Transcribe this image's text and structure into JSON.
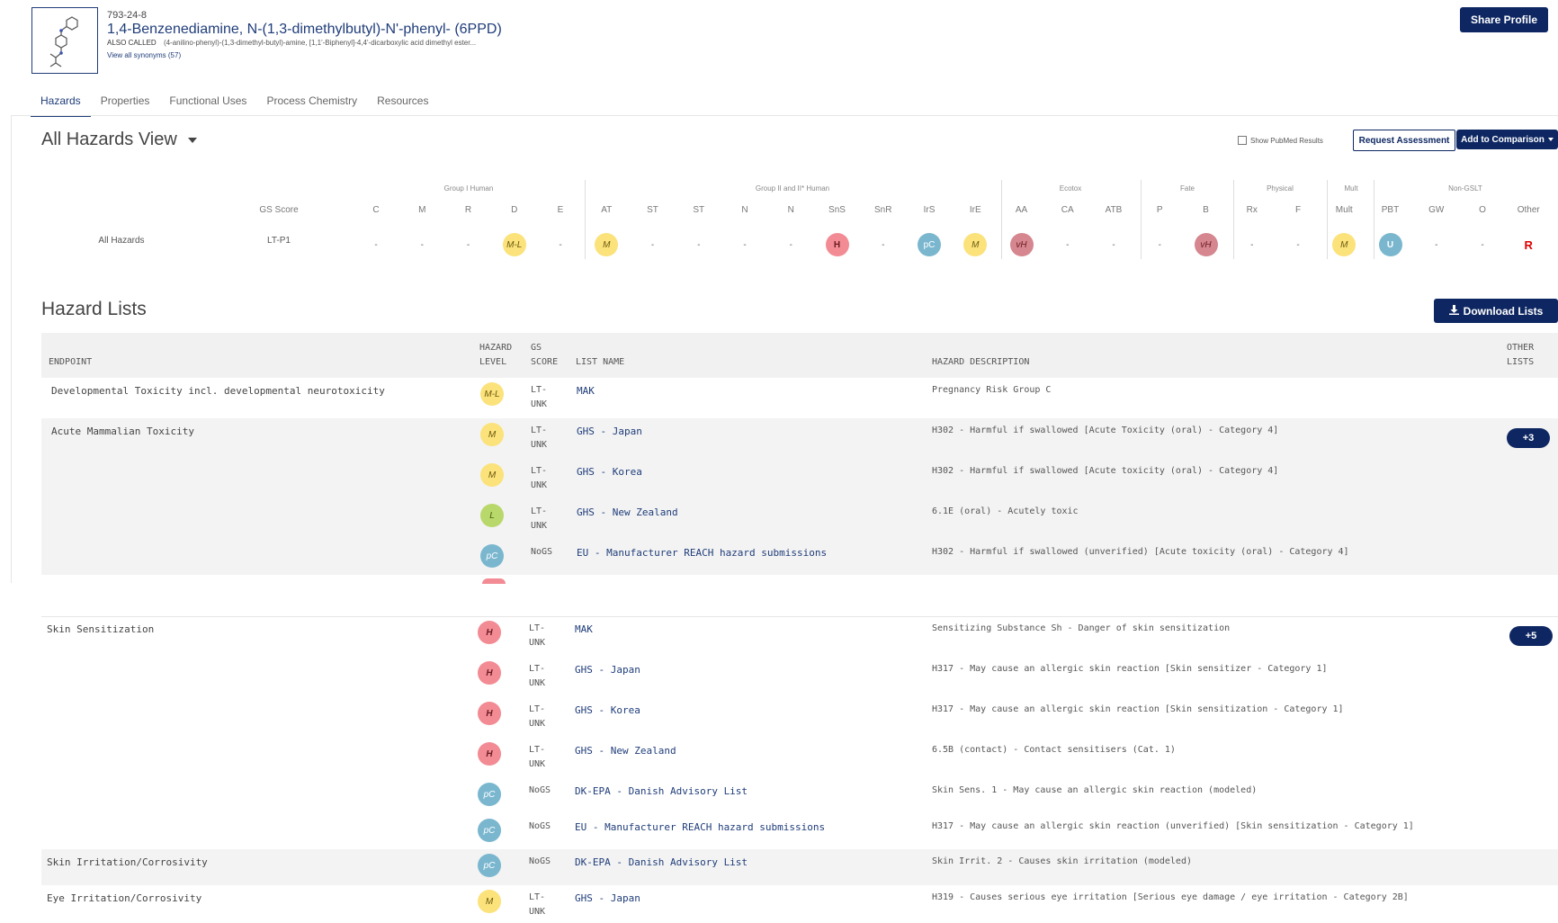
{
  "header": {
    "cas": "793-24-8",
    "name": "1,4-Benzenediamine, N-(1,3-dimethylbutyl)-N'-phenyl- (6PPD)",
    "also_called_label": "ALSO CALLED",
    "also_called": "(4-anilino-phenyl)-(1,3-dimethyl-butyl)-amine, [1,1'-Biphenyl]-4,4'-dicarboxylic acid dimethyl ester...",
    "synonyms_link": "View all synonyms (57)",
    "share_label": "Share Profile"
  },
  "tabs": [
    "Hazards",
    "Properties",
    "Functional Uses",
    "Process Chemistry",
    "Resources"
  ],
  "active_tab": "Hazards",
  "view": {
    "title": "All Hazards View",
    "pubmed_label": "Show PubMed Results",
    "request_label": "Request Assessment",
    "compare_label": "Add to Comparison"
  },
  "hazard_table": {
    "groups": [
      "Group I Human",
      "Group II and II* Human",
      "Ecotox",
      "Fate",
      "Physical",
      "Mult",
      "Non-GSLT"
    ],
    "score_label": "GS Score",
    "columns": [
      "C",
      "M",
      "R",
      "D",
      "E",
      "AT",
      "ST",
      "ST",
      "N",
      "N",
      "SnS",
      "SnR",
      "IrS",
      "IrE",
      "AA",
      "CA",
      "ATB",
      "P",
      "B",
      "Rx",
      "F",
      "Mult",
      "PBT",
      "GW",
      "O",
      "Other"
    ],
    "row_label": "All Hazards",
    "gs_score": "LT-P1",
    "values": [
      "-",
      "-",
      "-",
      "M-L",
      "-",
      "M",
      "-",
      "-",
      "-",
      "-",
      "H",
      "-",
      "pC",
      "M",
      "vH",
      "-",
      "-",
      "-",
      "vH",
      "-",
      "-",
      "M",
      "U",
      "-",
      "-",
      "R"
    ]
  },
  "lists": {
    "title": "Hazard Lists",
    "download_label": "Download Lists",
    "headers": {
      "endpoint": "ENDPOINT",
      "hazard_level": [
        "HAZARD",
        "LEVEL"
      ],
      "gs_score": [
        "GS",
        "SCORE"
      ],
      "list_name": "LIST NAME",
      "hazard_description": "HAZARD DESCRIPTION",
      "other_lists": [
        "OTHER",
        "LISTS"
      ]
    },
    "groups": [
      {
        "endpoint": "Developmental Toxicity incl. developmental neurotoxicity",
        "more": "",
        "rows": [
          {
            "level": "M-L",
            "gs": [
              "LT-",
              "UNK"
            ],
            "list": "MAK",
            "desc": "Pregnancy Risk Group C"
          }
        ]
      },
      {
        "endpoint": "Acute Mammalian Toxicity",
        "more": "+3",
        "rows": [
          {
            "level": "M",
            "gs": [
              "LT-",
              "UNK"
            ],
            "list": "GHS - Japan",
            "desc": "H302 - Harmful if swallowed [Acute Toxicity (oral) - Category 4]"
          },
          {
            "level": "M",
            "gs": [
              "LT-",
              "UNK"
            ],
            "list": "GHS - Korea",
            "desc": "H302 - Harmful if swallowed [Acute toxicity (oral) - Category 4]"
          },
          {
            "level": "L",
            "gs": [
              "LT-",
              "UNK"
            ],
            "list": "GHS - New Zealand",
            "desc": "6.1E (oral) - Acutely toxic"
          },
          {
            "level": "pC",
            "gs": [
              "NoGS",
              ""
            ],
            "list": "EU - Manufacturer REACH hazard submissions",
            "desc": "H302 - Harmful if swallowed (unverified) [Acute toxicity (oral) - Category 4]"
          }
        ]
      },
      {
        "endpoint": "Skin Sensitization",
        "more": "+5",
        "rows": [
          {
            "level": "H",
            "gs": [
              "LT-",
              "UNK"
            ],
            "list": "MAK",
            "desc": "Sensitizing Substance Sh - Danger of skin sensitization"
          },
          {
            "level": "H",
            "gs": [
              "LT-",
              "UNK"
            ],
            "list": "GHS - Japan",
            "desc": "H317 - May cause an allergic skin reaction [Skin sensitizer - Category 1]"
          },
          {
            "level": "H",
            "gs": [
              "LT-",
              "UNK"
            ],
            "list": "GHS - Korea",
            "desc": "H317 - May cause an allergic skin reaction [Skin sensitization - Category 1]"
          },
          {
            "level": "H",
            "gs": [
              "LT-",
              "UNK"
            ],
            "list": "GHS - New Zealand",
            "desc": "6.5B (contact) - Contact sensitisers (Cat. 1)"
          },
          {
            "level": "pC",
            "gs": [
              "NoGS",
              ""
            ],
            "list": "DK-EPA - Danish Advisory List",
            "desc": "Skin Sens. 1 - May cause an allergic skin reaction (modeled)"
          },
          {
            "level": "pC",
            "gs": [
              "NoGS",
              ""
            ],
            "list": "EU - Manufacturer REACH hazard submissions",
            "desc": "H317 - May cause an allergic skin reaction (unverified) [Skin sensitization - Category 1]"
          }
        ]
      },
      {
        "endpoint": "Skin Irritation/Corrosivity",
        "more": "",
        "rows": [
          {
            "level": "pC",
            "gs": [
              "NoGS",
              ""
            ],
            "list": "DK-EPA - Danish Advisory List",
            "desc": "Skin Irrit. 2 - Causes skin irritation (modeled)"
          }
        ]
      },
      {
        "endpoint": "Eye Irritation/Corrosivity",
        "more": "",
        "rows": [
          {
            "level": "M",
            "gs": [
              "LT-",
              "UNK"
            ],
            "list": "GHS - Japan",
            "desc": "H319 - Causes serious eye irritation [Serious eye damage / eye irritation - Category 2B]"
          }
        ]
      }
    ]
  },
  "colors": {
    "navy": "#0e2762",
    "M": "#fbe27a",
    "H": "#f28b93",
    "vH": "#d5868e",
    "pC": "#7ab7cf",
    "L": "#b8d86b",
    "R": "#e00000"
  }
}
